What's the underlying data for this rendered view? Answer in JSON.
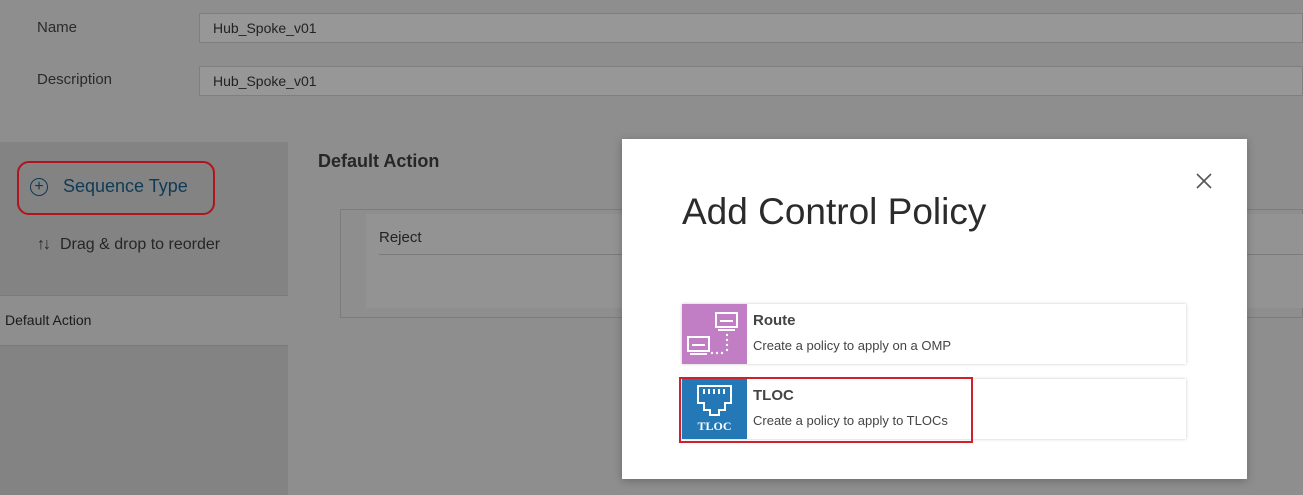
{
  "form": {
    "name_label": "Name",
    "name_value": "Hub_Spoke_v01",
    "description_label": "Description",
    "description_value": "Hub_Spoke_v01"
  },
  "sidebar": {
    "sequence_type_label": "Sequence Type",
    "drag_label": "Drag & drop to reorder",
    "items": [
      {
        "label": "Default Action"
      }
    ]
  },
  "main": {
    "section_title": "Default Action",
    "action_value": "Reject"
  },
  "modal": {
    "title": "Add Control Policy",
    "options": [
      {
        "title": "Route",
        "description": "Create a policy to apply on a OMP",
        "icon": "route-icon",
        "color": "#c17ec4"
      },
      {
        "title": "TLOC",
        "description": "Create a policy to apply to TLOCs",
        "icon": "tloc-icon",
        "color": "#2378b5",
        "icon_text": "TLOC"
      }
    ]
  },
  "colors": {
    "highlight": "#d0202c",
    "overlay_bg": "#8e8e8e"
  }
}
